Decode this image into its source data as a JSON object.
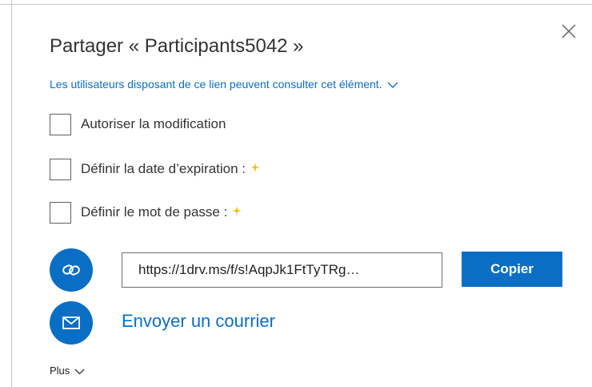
{
  "dialog": {
    "title": "Partager « Participants5042 »",
    "permission_text": "Les utilisateurs disposant de ce lien peuvent consulter cet élément.",
    "permission_icon": "chevron-down-icon",
    "close_icon": "close-icon"
  },
  "options": [
    {
      "label": "Autoriser la modification",
      "checked": false,
      "premium": false
    },
    {
      "label": "Définir la date d’expiration :",
      "checked": false,
      "premium": true
    },
    {
      "label": "Définir le mot de passe :",
      "checked": false,
      "premium": true
    }
  ],
  "link": {
    "icon": "link-icon",
    "value": "https://1drv.ms/f/s!AqpJk1FtTyTRg…",
    "copy_label": "Copier"
  },
  "email": {
    "icon": "mail-icon",
    "label": "Envoyer un courrier"
  },
  "more": {
    "label": "Plus",
    "icon": "chevron-down-icon"
  },
  "colors": {
    "accent": "#0a6ec5",
    "premium_star": "#f2b600",
    "text": "#333333"
  }
}
